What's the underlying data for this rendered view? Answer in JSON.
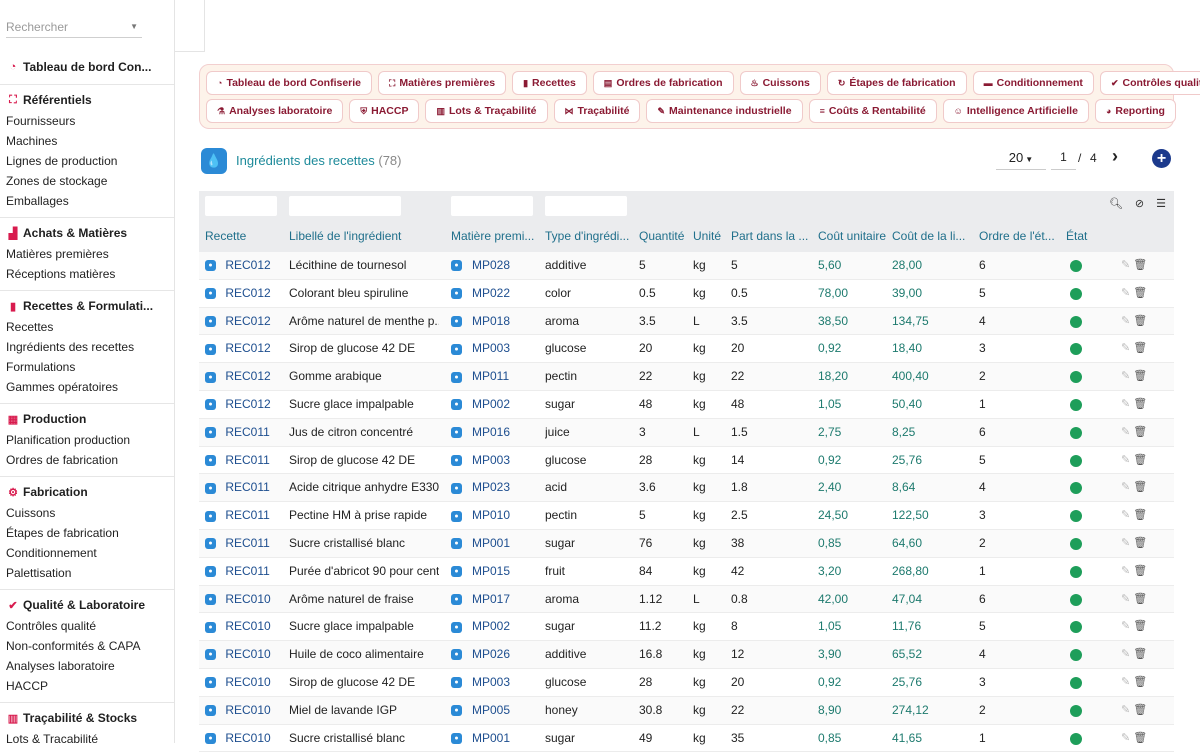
{
  "search": {
    "placeholder": "Rechercher"
  },
  "sidebar": {
    "sections": [
      {
        "icon": "dashboard-icon",
        "glyph": "◔",
        "title": "Tableau de bord Con...",
        "items": []
      },
      {
        "icon": "hierarchy-icon",
        "glyph": "⛶",
        "title": "Référentiels",
        "items": [
          "Fournisseurs",
          "Machines",
          "Lignes de production",
          "Zones de stockage",
          "Emballages"
        ]
      },
      {
        "icon": "factory-icon",
        "glyph": "▟",
        "title": "Achats & Matières",
        "items": [
          "Matières premières",
          "Réceptions matières"
        ]
      },
      {
        "icon": "book-icon",
        "glyph": "▮",
        "title": "Recettes & Formulati...",
        "items": [
          "Recettes",
          "Ingrédients des recettes",
          "Formulations",
          "Gammes opératoires"
        ]
      },
      {
        "icon": "calendar-icon",
        "glyph": "▦",
        "title": "Production",
        "items": [
          "Planification production",
          "Ordres de fabrication"
        ]
      },
      {
        "icon": "gears-icon",
        "glyph": "⚙",
        "title": "Fabrication",
        "items": [
          "Cuissons",
          "Étapes de fabrication",
          "Conditionnement",
          "Palettisation"
        ]
      },
      {
        "icon": "check-circle-icon",
        "glyph": "✔",
        "title": "Qualité & Laboratoire",
        "items": [
          "Contrôles qualité",
          "Non-conformités & CAPA",
          "Analyses laboratoire",
          "HACCP"
        ]
      },
      {
        "icon": "barcode-icon",
        "glyph": "▥",
        "title": "Traçabilité & Stocks",
        "items": [
          "Lots & Traçabilité"
        ]
      }
    ]
  },
  "menu": {
    "row1": [
      {
        "label": "Tableau de bord Confiserie",
        "icon": "dashboard-icon",
        "glyph": "◔"
      },
      {
        "label": "Matières premières",
        "icon": "hierarchy-icon",
        "glyph": "⛶"
      },
      {
        "label": "Recettes",
        "icon": "book-icon",
        "glyph": "▮"
      },
      {
        "label": "Ordres de fabrication",
        "icon": "clipboard-icon",
        "glyph": "▤"
      },
      {
        "label": "Cuissons",
        "icon": "flame-icon",
        "glyph": "♨"
      },
      {
        "label": "Étapes de fabrication",
        "icon": "refresh-icon",
        "glyph": "↻"
      },
      {
        "label": "Conditionnement",
        "icon": "box-icon",
        "glyph": "▬"
      },
      {
        "label": "Contrôles qualité",
        "icon": "check-circle-icon",
        "glyph": "✔"
      }
    ],
    "row2": [
      {
        "label": "Analyses laboratoire",
        "icon": "flask-icon",
        "glyph": "⚗"
      },
      {
        "label": "HACCP",
        "icon": "shield-icon",
        "glyph": "⛨"
      },
      {
        "label": "Lots & Traçabilité",
        "icon": "barcode-icon",
        "glyph": "▥"
      },
      {
        "label": "Traçabilité",
        "icon": "network-icon",
        "glyph": "⋈"
      },
      {
        "label": "Maintenance industrielle",
        "icon": "wrench-icon",
        "glyph": "✎"
      },
      {
        "label": "Coûts & Rentabilité",
        "icon": "money-icon",
        "glyph": "≡"
      },
      {
        "label": "Intelligence Artificielle",
        "icon": "robot-icon",
        "glyph": "☺"
      },
      {
        "label": "Reporting",
        "icon": "pie-chart-icon",
        "glyph": "◕"
      }
    ]
  },
  "header": {
    "title": "Ingrédients des recettes",
    "count": "(78)"
  },
  "pager": {
    "page_size": "20",
    "page": "1",
    "separator": "/",
    "total_pages": "4"
  },
  "columns": [
    "Recette",
    "Libellé de l'ingrédient",
    "Matière premi...",
    "Type d'ingrédi...",
    "Quantité",
    "Unité",
    "Part dans la ...",
    "Coût unitaire",
    "Coût de la li...",
    "Ordre de l'ét...",
    "État"
  ],
  "rows": [
    [
      "REC012",
      "Lécithine de tournesol",
      "MP028",
      "additive",
      "5",
      "kg",
      "5",
      "5,60",
      "28,00",
      "6"
    ],
    [
      "REC012",
      "Colorant bleu spiruline",
      "MP022",
      "color",
      "0.5",
      "kg",
      "0.5",
      "78,00",
      "39,00",
      "5"
    ],
    [
      "REC012",
      "Arôme naturel de menthe p...",
      "MP018",
      "aroma",
      "3.5",
      "L",
      "3.5",
      "38,50",
      "134,75",
      "4"
    ],
    [
      "REC012",
      "Sirop de glucose 42 DE",
      "MP003",
      "glucose",
      "20",
      "kg",
      "20",
      "0,92",
      "18,40",
      "3"
    ],
    [
      "REC012",
      "Gomme arabique",
      "MP011",
      "pectin",
      "22",
      "kg",
      "22",
      "18,20",
      "400,40",
      "2"
    ],
    [
      "REC012",
      "Sucre glace impalpable",
      "MP002",
      "sugar",
      "48",
      "kg",
      "48",
      "1,05",
      "50,40",
      "1"
    ],
    [
      "REC011",
      "Jus de citron concentré",
      "MP016",
      "juice",
      "3",
      "L",
      "1.5",
      "2,75",
      "8,25",
      "6"
    ],
    [
      "REC011",
      "Sirop de glucose 42 DE",
      "MP003",
      "glucose",
      "28",
      "kg",
      "14",
      "0,92",
      "25,76",
      "5"
    ],
    [
      "REC011",
      "Acide citrique anhydre E330",
      "MP023",
      "acid",
      "3.6",
      "kg",
      "1.8",
      "2,40",
      "8,64",
      "4"
    ],
    [
      "REC011",
      "Pectine HM à prise rapide",
      "MP010",
      "pectin",
      "5",
      "kg",
      "2.5",
      "24,50",
      "122,50",
      "3"
    ],
    [
      "REC011",
      "Sucre cristallisé blanc",
      "MP001",
      "sugar",
      "76",
      "kg",
      "38",
      "0,85",
      "64,60",
      "2"
    ],
    [
      "REC011",
      "Purée d'abricot 90 pour cent",
      "MP015",
      "fruit",
      "84",
      "kg",
      "42",
      "3,20",
      "268,80",
      "1"
    ],
    [
      "REC010",
      "Arôme naturel de fraise",
      "MP017",
      "aroma",
      "1.12",
      "L",
      "0.8",
      "42,00",
      "47,04",
      "6"
    ],
    [
      "REC010",
      "Sucre glace impalpable",
      "MP002",
      "sugar",
      "11.2",
      "kg",
      "8",
      "1,05",
      "11,76",
      "5"
    ],
    [
      "REC010",
      "Huile de coco alimentaire",
      "MP026",
      "additive",
      "16.8",
      "kg",
      "12",
      "3,90",
      "65,52",
      "4"
    ],
    [
      "REC010",
      "Sirop de glucose 42 DE",
      "MP003",
      "glucose",
      "28",
      "kg",
      "20",
      "0,92",
      "25,76",
      "3"
    ],
    [
      "REC010",
      "Miel de lavande IGP",
      "MP005",
      "honey",
      "30.8",
      "kg",
      "22",
      "8,90",
      "274,12",
      "2"
    ],
    [
      "REC010",
      "Sucre cristallisé blanc",
      "MP001",
      "sugar",
      "49",
      "kg",
      "35",
      "0,85",
      "41,65",
      "1"
    ]
  ],
  "colors": {
    "accent": "#d81b4e",
    "status_ok": "#1e9e5a",
    "link": "#1d4e8f"
  }
}
